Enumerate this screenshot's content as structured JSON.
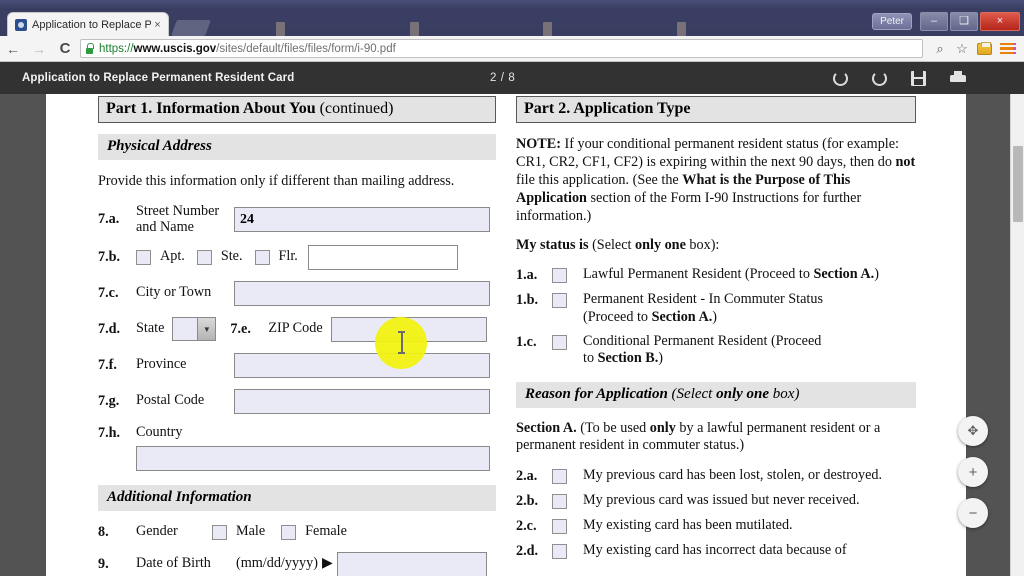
{
  "window": {
    "user_label": "Peter",
    "minimize": "–",
    "maximize": "❑",
    "close": "×"
  },
  "browser": {
    "tab": {
      "title": "Application to Replace Pe",
      "close_label": "×",
      "favicon": "globe-icon"
    },
    "nav": {
      "back": "←",
      "forward": "→",
      "reload": "C"
    },
    "omnibox": {
      "lock": "lock-icon",
      "scheme": "https://",
      "host": "www.uscis.gov",
      "path": "/sites/default/files/files/form/i-90.pdf",
      "full_url": "https://www.uscis.gov/sites/default/files/files/form/i-90.pdf"
    },
    "actions": {
      "zoom": "⌕",
      "bookmark": "☆",
      "extension": "folder-extension-icon",
      "menu": "hamburger-menu-icon"
    }
  },
  "pdf_viewer": {
    "document_title": "Application to Replace Permanent Resident Card",
    "page_indicator": "2 / 8",
    "tools": {
      "rotate_cw": "rotate-clockwise-icon",
      "rotate_ccw": "rotate-counterclockwise-icon",
      "save": "save-icon",
      "print": "print-icon"
    },
    "zoom_controls": {
      "fit": "✥",
      "zoom_in": "+",
      "zoom_out": "−"
    }
  },
  "form": {
    "part1": {
      "heading_bold": "Part 1.  Information About You",
      "heading_sub": " (continued)",
      "section_band": "Physical Address",
      "instruction": "Provide this information only if different than mailing address.",
      "fields": [
        {
          "num": "7.a.",
          "label_line1": "Street Number",
          "label_line2": "and Name",
          "value": "24"
        },
        {
          "num": "7.b.",
          "checkboxes": [
            "Apt.",
            "Ste.",
            "Flr."
          ],
          "value": ""
        },
        {
          "num": "7.c.",
          "label": "City or Town",
          "value": ""
        },
        {
          "num": "7.d.",
          "label": "State",
          "value": ""
        },
        {
          "num": "7.e.",
          "label": "ZIP Code",
          "value": ""
        },
        {
          "num": "7.f.",
          "label": "Province",
          "value": ""
        },
        {
          "num": "7.g.",
          "label": "Postal Code",
          "value": ""
        },
        {
          "num": "7.h.",
          "label": "Country",
          "value": ""
        }
      ],
      "additional_band": "Additional Information",
      "gender": {
        "num": "8.",
        "label": "Gender",
        "options": [
          "Male",
          "Female"
        ]
      },
      "dob": {
        "num": "9.",
        "label": "Date of Birth",
        "format": "(mm/dd/yyyy)",
        "arrow": "▶",
        "value": ""
      }
    },
    "part2": {
      "heading": "Part 2.  Application Type",
      "note_label": "NOTE:",
      "note_p1": " If your conditional permanent resident status (for example:  CR1, CR2, CF1, CF2) is expiring within the next 90 days, then do ",
      "note_not": "not",
      "note_p2": " file this application.  (See the ",
      "note_bold2": "What is the Purpose of This Application",
      "note_p3": " section of the Form I-90 Instructions for further information.)",
      "status_label": "My status is",
      "status_hint_pre": " (Select ",
      "status_hint_bold": "only one",
      "status_hint_post": " box):",
      "status_options": [
        {
          "num": "1.a.",
          "text": "Lawful Permanent Resident (Proceed to ",
          "bold": "Section A.",
          "tail": ")"
        },
        {
          "num": "1.b.",
          "text": "Permanent Resident - In Commuter Status (Proceed to ",
          "bold": "Section A.",
          "tail": ")"
        },
        {
          "num": "1.c.",
          "text": "Conditional Permanent Resident (Proceed to ",
          "bold": "Section B.",
          "tail": ")"
        }
      ],
      "reason_band_main": "Reason for Application ",
      "reason_band_sub1": "(Select ",
      "reason_band_sub_bold": "only one",
      "reason_band_sub2": " box)",
      "section_a_label": "Section A.",
      "section_a_pre": "  (To be used ",
      "section_a_bold": "only",
      "section_a_post": " by a lawful permanent resident or a permanent resident in commuter status.)",
      "reason_options": [
        {
          "num": "2.a.",
          "text": "My previous card has been lost, stolen, or destroyed."
        },
        {
          "num": "2.b.",
          "text": "My previous card was issued but never received."
        },
        {
          "num": "2.c.",
          "text": "My existing card has been mutilated."
        },
        {
          "num": "2.d.",
          "text": "My existing card has incorrect data because of"
        }
      ]
    }
  }
}
